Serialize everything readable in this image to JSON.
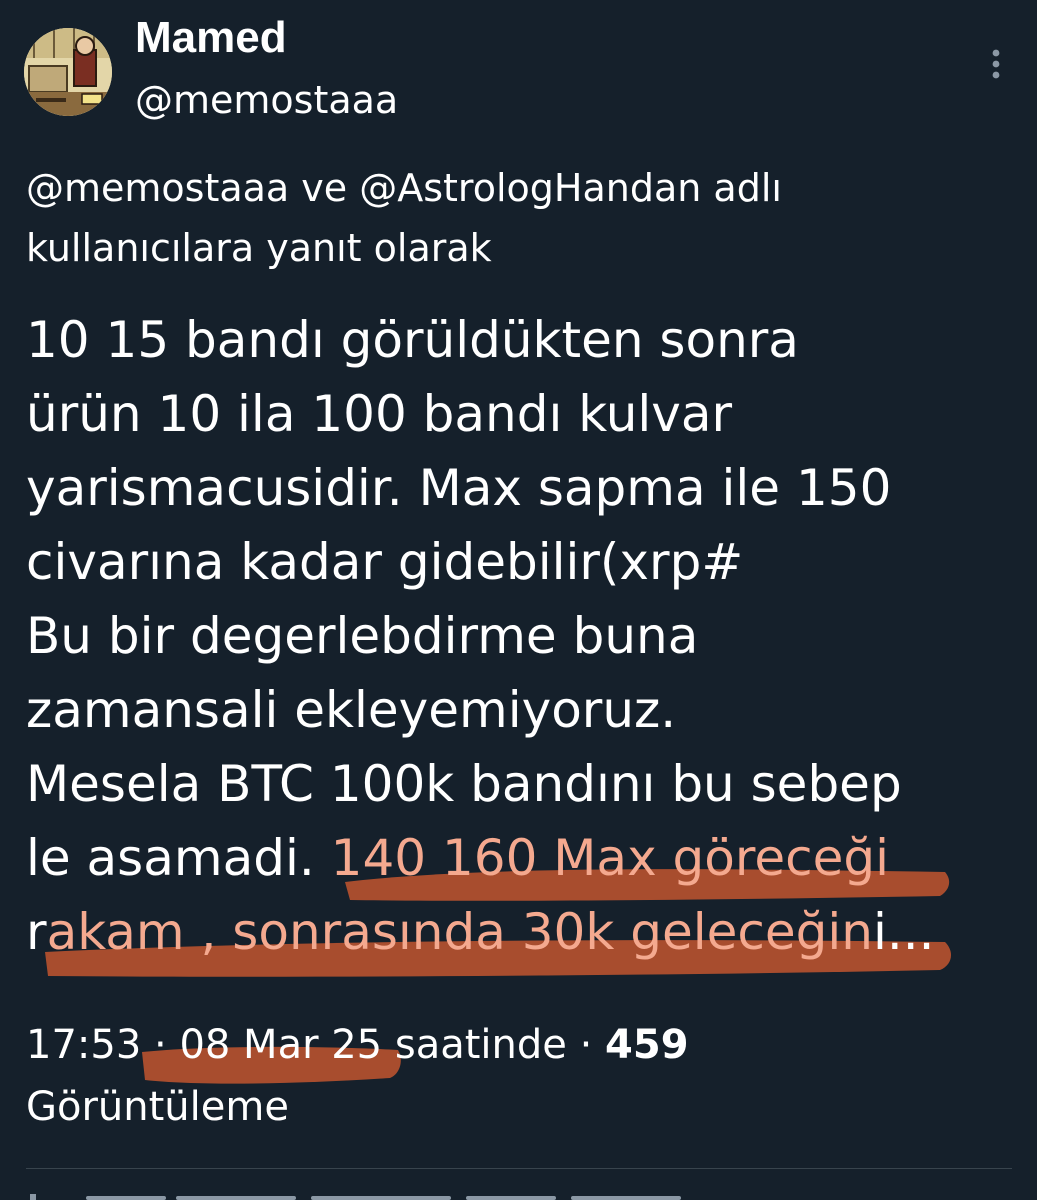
{
  "tweet": {
    "display_name": "Mamed",
    "handle": "@memostaaa",
    "reply_context": "@memostaaa ve @AstrologHandan adlı kullanıcılara yanıt olarak",
    "body_lines": [
      "10 15 bandı görüldükten sonra",
      "ürün 10 ila 100 bandı kulvar",
      "yarismacusidir. Max sapma ile 150",
      "civarına kadar gidebilir(xrp#",
      "Bu bir degerlebdirme buna",
      "zamansali ekleyemiyoruz.",
      "Mesela BTC 100k bandını bu sebep"
    ],
    "line8_plain": "le asamadi. ",
    "line8_highlight": "140 160 Max göreceği",
    "line9_first": "r",
    "line9_highlight": "akam , sonrasında 30k geleceğin",
    "line9_rest": "i...",
    "time": "17:53",
    "date": "08 Mar 25",
    "date_suffix": "saatinde",
    "separator": "·",
    "views_count": "459",
    "views_label": "Görüntüleme"
  },
  "colors": {
    "background": "#15202b",
    "text": "#ffffff",
    "highlight_text": "#f4a98f",
    "marker": "#b5512f",
    "divider": "#38444d"
  },
  "icons": {
    "more": "more-vertical-icon",
    "avatar": "cartoon-avatar"
  }
}
